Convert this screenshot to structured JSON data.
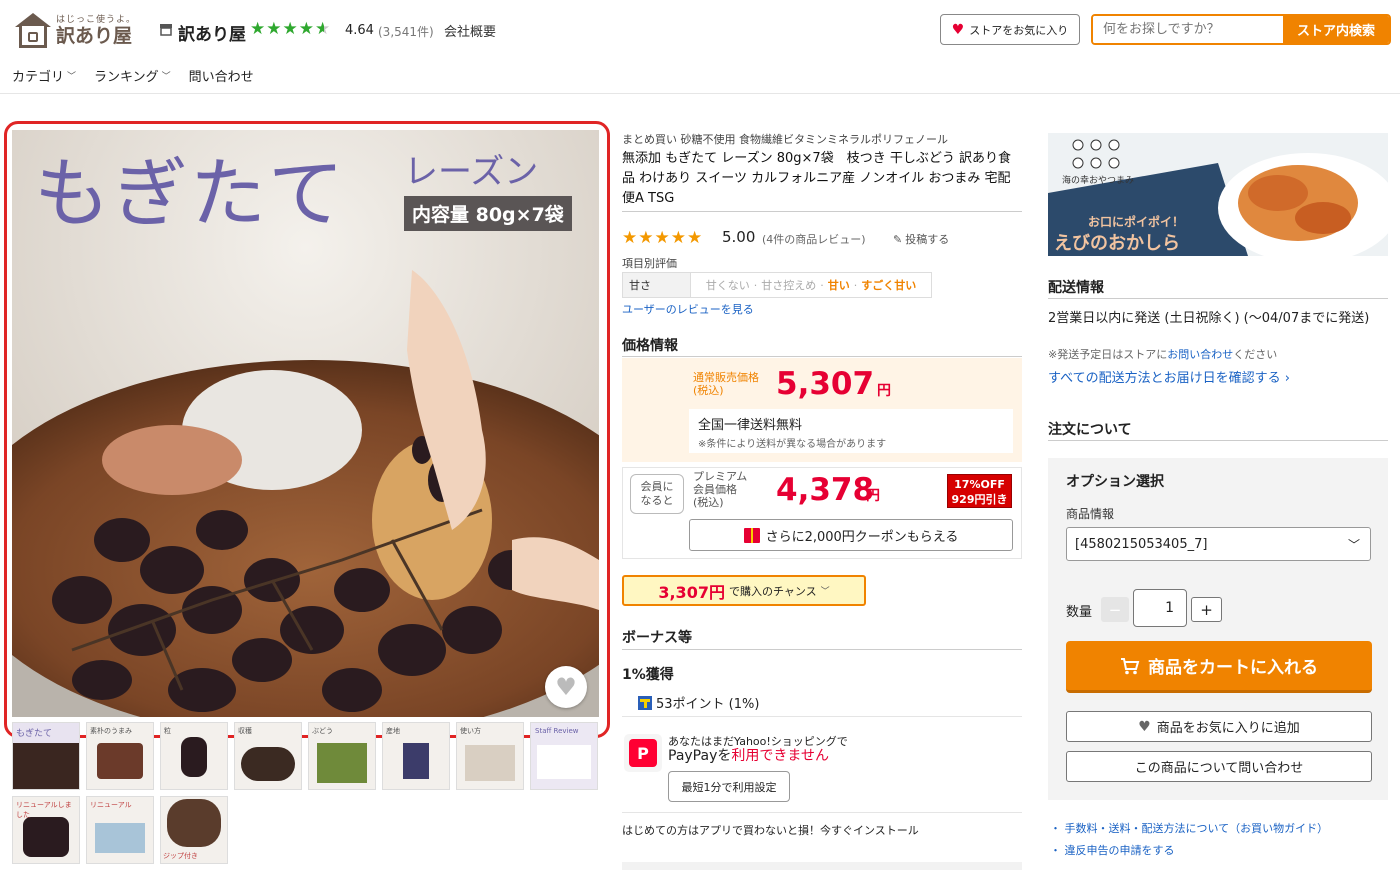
{
  "header": {
    "logo_sub": "はじっこ使うよ。",
    "logo_main": "訳あり屋",
    "store_name": "訳あり屋",
    "rating": "4.64",
    "rating_count": "(3,541件)",
    "company_link": "会社概要",
    "favorite_store_label": "ストアをお気に入り",
    "search_placeholder": "何をお探しですか？",
    "search_button": "ストア内検索"
  },
  "nav": [
    {
      "label": "カテゴリ",
      "dropdown": true
    },
    {
      "label": "ランキング",
      "dropdown": true
    },
    {
      "label": "問い合わせ",
      "dropdown": false
    }
  ],
  "main_image": {
    "title": "もぎたて",
    "subtitle": "レーズン",
    "capacity": "内容量 80g×7袋"
  },
  "thumbnails": [
    {
      "caption": "もぎたて"
    },
    {
      "caption": "素朴のうまみ"
    },
    {
      "caption": "粒"
    },
    {
      "caption": "収穫"
    },
    {
      "caption": "ぶどう"
    },
    {
      "caption": "産地"
    },
    {
      "caption": "使い方"
    },
    {
      "caption": "Staff Review"
    },
    {
      "caption": "リニューアルしました"
    },
    {
      "caption": "リニューアル"
    },
    {
      "caption": "ジップ付き"
    }
  ],
  "product": {
    "tagline": "まとめ買い 砂糖不使用 食物繊維ビタミンミネラルポリフェノール",
    "title": "無添加 もぎたて レーズン 80g×7袋　枝つき 干しぶどう 訳あり食品 わけあり スイーツ カルフォルニア産 ノンオイル おつまみ 宅配便A TSG",
    "review_score": "5.00",
    "review_count": "(4件の商品レビュー)",
    "write_review": "投稿する",
    "sub_eval_label": "項目別評価",
    "sweet_label": "甘さ",
    "sweet_scale": [
      "甘くない",
      "甘さ控えめ",
      "甘い",
      "すごく甘い"
    ],
    "sweet_selected": "甘い",
    "review_link": "ユーザーのレビューを見る"
  },
  "price": {
    "heading": "価格情報",
    "regular_label_1": "通常販売価格",
    "regular_label_2": "(税込)",
    "regular_price": "5,307",
    "yen": "円",
    "shipping_free": "全国一律送料無料",
    "shipping_note": "※条件により送料が異なる場合があります",
    "member_badge_1": "会員に",
    "member_badge_2": "なると",
    "member_label_1": "プレミアム",
    "member_label_2": "会員価格",
    "member_label_3": "(税込)",
    "member_price": "4,378",
    "off_percent": "17%OFF",
    "off_amount": "929円引き",
    "coupon_label": "さらに2,000円クーポンもらえる",
    "chance_price": "3,307円",
    "chance_label": "で購入のチャンス"
  },
  "bonus": {
    "heading": "ボーナス等",
    "rate": "1%獲得",
    "points": "53ポイント (1%)",
    "paypay_line1": "あなたはまだYahoo!ショッピングで",
    "paypay_line2_a": "PayPayを",
    "paypay_line2_b": "利用できません",
    "setup_button": "最短1分で利用設定",
    "app_promo": "はじめての方はアプリで買わないと損！今すぐインストール"
  },
  "banner": {
    "brand": "海の幸おやつまみ",
    "tagline": "お口にポイポイ！",
    "title": "えびのおかしら"
  },
  "shipping": {
    "heading": "配送情報",
    "days": "2営業日以内に発送 (土日祝除く) (〜04/07までに発送)",
    "contact_prefix": "※発送予定日はストアに",
    "contact_link": "お問い合わせ",
    "contact_suffix": "ください",
    "all_methods": "すべての配送方法とお届け日を確認する"
  },
  "order": {
    "heading": "注文について",
    "option_title": "オプション選択",
    "product_info_label": "商品情報",
    "option_value": "[4580215053405_7]",
    "qty_label": "数量",
    "qty_value": "1",
    "cart_button": "商品をカートに入れる",
    "fav_button": "商品をお気に入りに追加",
    "inquiry_button": "この商品について問い合わせ",
    "guide_link": "手数料・送料・配送方法について（お買い物ガイド）",
    "report_link": "違反申告の申請をする"
  },
  "colors": {
    "accent": "#f08300",
    "price_red": "#e60033",
    "link_blue": "#1a62c4",
    "star_green": "#2fa82f",
    "star_orange": "#f39800",
    "highlight_frame": "#e02525"
  }
}
